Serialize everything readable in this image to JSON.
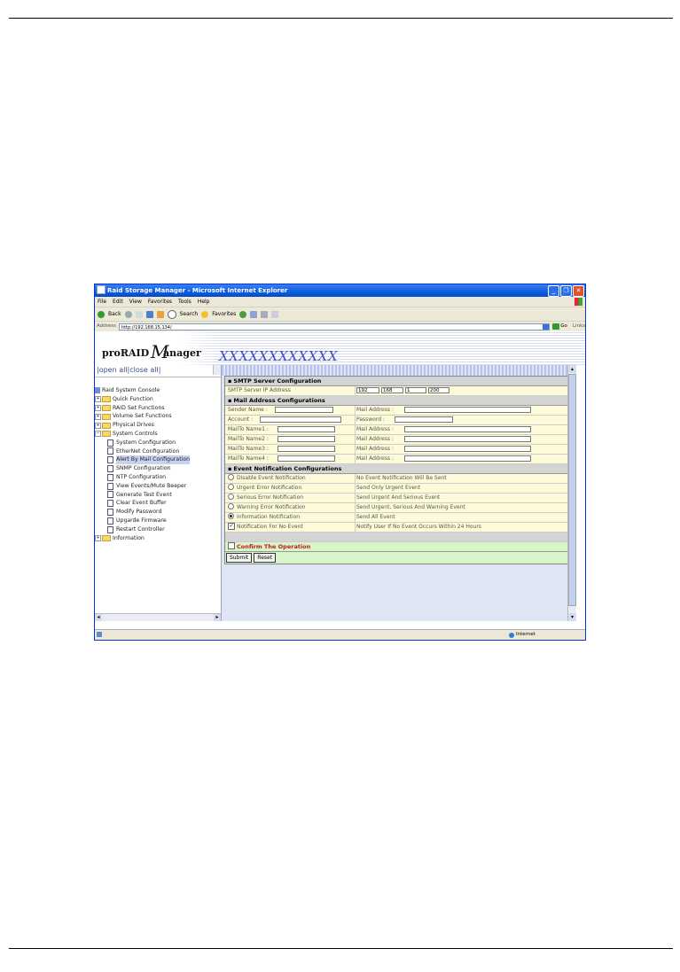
{
  "browser": {
    "title": "Raid Storage Manager - Microsoft Internet Explorer",
    "menu": [
      "File",
      "Edit",
      "View",
      "Favorites",
      "Tools",
      "Help"
    ],
    "toolbar": {
      "back": "Back",
      "search": "Search",
      "favorites": "Favorites"
    },
    "address_label": "Address",
    "address": "http://192.168.15.134/",
    "go": "Go",
    "links": "Links",
    "status_zone": "Internet"
  },
  "banner": {
    "logo_pro": "proRAID",
    "logo_m": "M",
    "logo_anager": "anager",
    "product": "XXXXXXXXXXXX"
  },
  "sidebar": {
    "top_links": "|open all|close all|",
    "root": "Raid System Console",
    "items": [
      {
        "label": "Quick Function",
        "type": "folder",
        "exp": "+"
      },
      {
        "label": "RAID Set Functions",
        "type": "folder",
        "exp": "+"
      },
      {
        "label": "Volume Set Functions",
        "type": "folder",
        "exp": "+"
      },
      {
        "label": "Physical Drives",
        "type": "folder",
        "exp": "+"
      },
      {
        "label": "System Controls",
        "type": "folder",
        "exp": "−"
      },
      {
        "label": "System Configuration",
        "type": "doc"
      },
      {
        "label": "EtherNet Configuration",
        "type": "doc"
      },
      {
        "label": "Alert By Mail Configuration",
        "type": "doc",
        "selected": true
      },
      {
        "label": "SNMP Configuration",
        "type": "doc"
      },
      {
        "label": "NTP Configuration",
        "type": "doc"
      },
      {
        "label": "View Events/Mute Beeper",
        "type": "doc"
      },
      {
        "label": "Generate Test Event",
        "type": "doc"
      },
      {
        "label": "Clear Event Buffer",
        "type": "doc"
      },
      {
        "label": "Modify Password",
        "type": "doc"
      },
      {
        "label": "Upgarde Firmware",
        "type": "doc"
      },
      {
        "label": "Restart Controller",
        "type": "doc"
      },
      {
        "label": "Information",
        "type": "folder",
        "exp": "+"
      }
    ]
  },
  "form": {
    "smtp_header": "SMTP Server Configuration",
    "smtp_label": "SMTP Server IP Address",
    "smtp_ip": [
      "192",
      "168",
      "1",
      "200"
    ],
    "mail_header": "Mail Address Configurations",
    "sender_name": "Sender Name :",
    "mail_address": "Mail Address :",
    "account": "Account :",
    "password": "Password :",
    "mailto": [
      "MailTo Name1 :",
      "MailTo Name2 :",
      "MailTo Name3 :",
      "MailTo Name4 :"
    ],
    "event_header": "Event Notification Configurations",
    "events": [
      {
        "label": "Disable Event Notification",
        "desc": "No Event Notification Will Be Sent",
        "checked": false
      },
      {
        "label": "Urgent Error Notification",
        "desc": "Send Only Urgent Event",
        "checked": false
      },
      {
        "label": "Serious Error Notification",
        "desc": "Send Urgent And Serious Event",
        "checked": false
      },
      {
        "label": "Warning Error Notification",
        "desc": "Send Urgent, Serious And Warning Event",
        "checked": false
      },
      {
        "label": "Information Notification",
        "desc": "Send All Event",
        "checked": true
      }
    ],
    "no_event_label": "Notification For No Event",
    "no_event_desc": "Notify User If No Event Occurs Within 24 Hours",
    "no_event_checked": "✓",
    "confirm": "Confirm The Operation",
    "submit": "Submit",
    "reset": "Reset"
  }
}
